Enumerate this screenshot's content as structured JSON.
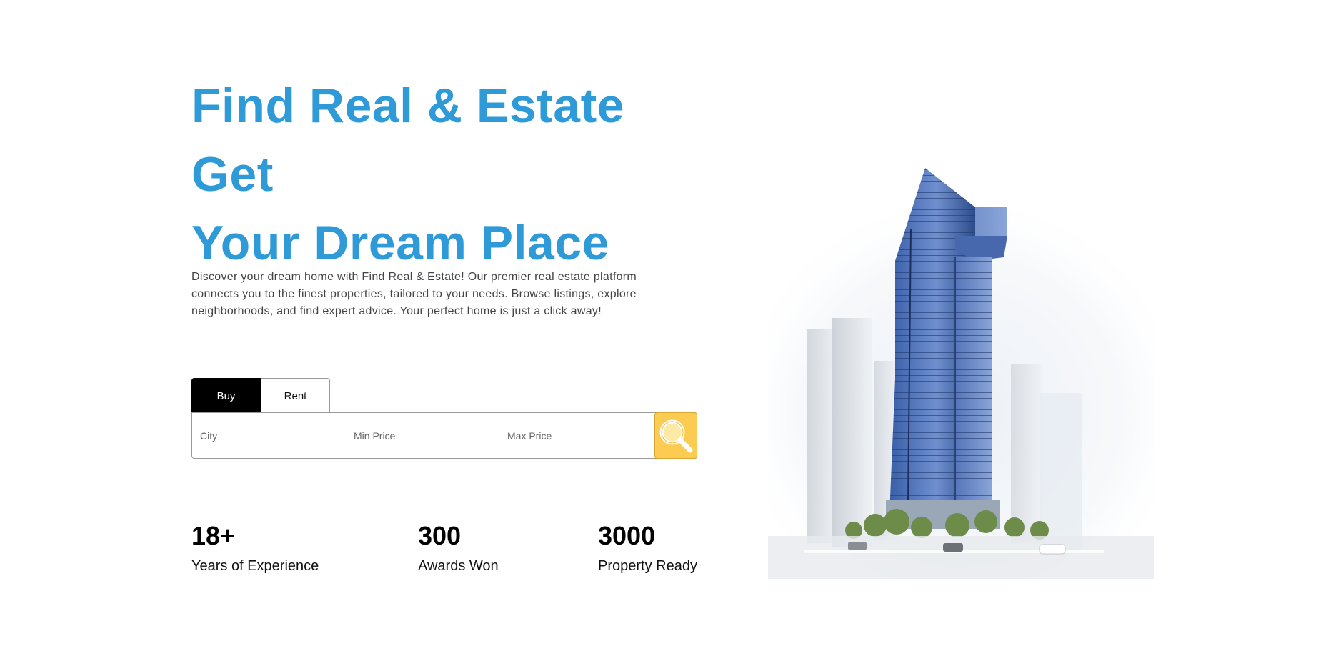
{
  "hero": {
    "title_line1": "Find Real & Estate Get",
    "title_line2": "Your Dream Place",
    "description": "Discover your dream home with Find Real & Estate! Our premier real estate platform connects you to the finest properties, tailored to your needs. Browse listings, explore neighborhoods, and find expert advice. Your perfect home is just a click away!",
    "title_color": "#2e9ad8"
  },
  "search": {
    "tabs": [
      {
        "label": "Buy",
        "active": true
      },
      {
        "label": "Rent",
        "active": false
      }
    ],
    "city_placeholder": "City",
    "min_price_placeholder": "Min Price",
    "max_price_placeholder": "Max Price",
    "button_icon": "search-icon",
    "button_color": "#fccb52"
  },
  "stats": [
    {
      "value": "18+",
      "label": "Years of Experience"
    },
    {
      "value": "300",
      "label": "Awards Won"
    },
    {
      "value": "3000",
      "label": "Property Ready"
    }
  ],
  "image": {
    "subject": "skyscraper-building"
  }
}
